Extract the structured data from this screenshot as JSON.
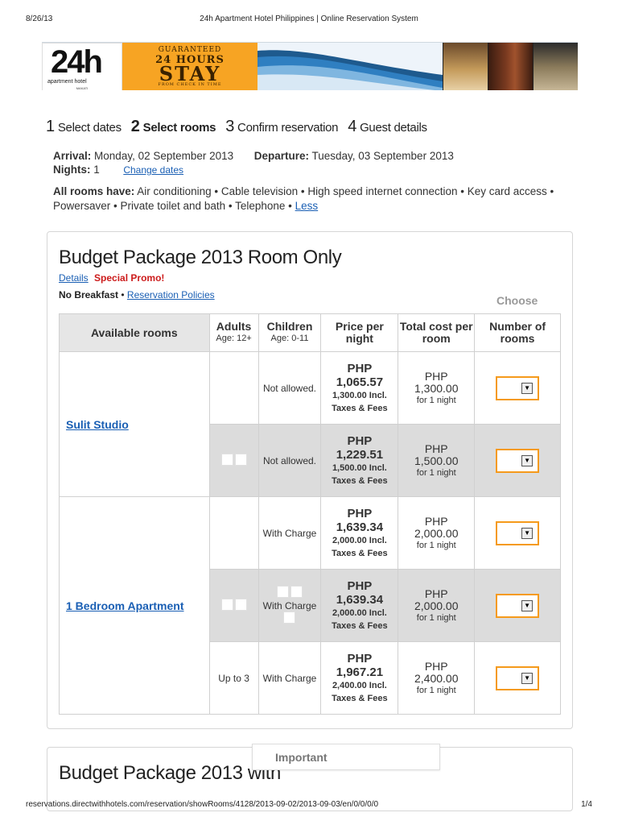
{
  "print_header": {
    "date": "8/26/13",
    "title": "24h Apartment Hotel Philippines | Online Reservation System"
  },
  "banner": {
    "logo_big": "24h",
    "logo_small": "apartment hotel",
    "logo_tiny": "MAKATI",
    "promo_l1": "GUARANTEED",
    "promo_l2": "24 HOURS",
    "promo_l3": "STAY",
    "promo_l4": "FROM CHECK IN TIME"
  },
  "steps": [
    {
      "num": "1",
      "label": "Select dates"
    },
    {
      "num": "2",
      "label": "Select rooms"
    },
    {
      "num": "3",
      "label": "Confirm reservation"
    },
    {
      "num": "4",
      "label": "Guest details"
    }
  ],
  "stay": {
    "arrival_label": "Arrival:",
    "arrival_value": "Monday, 02 September 2013",
    "departure_label": "Departure:",
    "departure_value": "Tuesday, 03 September 2013",
    "nights_label": "Nights:",
    "nights_value": "1",
    "change_dates": "Change dates"
  },
  "amenities": {
    "label": "All rooms have:",
    "text": "Air conditioning • Cable television • High speed internet connection • Key card access • Powersaver • Private toilet and bath • Telephone •",
    "less_link": "Less"
  },
  "package": {
    "title": "Budget Package 2013 Room Only",
    "details_link": "Details",
    "special_promo": "Special Promo!",
    "no_breakfast": "No Breakfast",
    "bullet": "•",
    "policies_link": "Reservation Policies",
    "choose": "Choose",
    "headers": {
      "available": "Available rooms",
      "adults": "Adults",
      "adults_sub": "Age: 12+",
      "children": "Children",
      "children_sub": "Age: 0-11",
      "price": "Price per night",
      "total": "Total cost per room",
      "number": "Number of rooms"
    },
    "rooms": [
      {
        "name": "Sulit Studio",
        "rows": [
          {
            "adults": "",
            "children": "Not allowed.",
            "currency": "PHP",
            "price": "1,065.57",
            "incl": "1,300.00 Incl.",
            "taxes": "Taxes & Fees",
            "total_cur": "PHP",
            "total": "1,300.00",
            "for_nights": "for 1 night"
          },
          {
            "adults": "",
            "children": "Not allowed.",
            "currency": "PHP",
            "price": "1,229.51",
            "incl": "1,500.00 Incl.",
            "taxes": "Taxes & Fees",
            "total_cur": "PHP",
            "total": "1,500.00",
            "for_nights": "for 1 night"
          }
        ]
      },
      {
        "name": "1 Bedroom Apartment",
        "rows": [
          {
            "adults": "",
            "children": "With Charge",
            "currency": "PHP",
            "price": "1,639.34",
            "incl": "2,000.00 Incl.",
            "taxes": "Taxes & Fees",
            "total_cur": "PHP",
            "total": "2,000.00",
            "for_nights": "for 1 night"
          },
          {
            "adults": "",
            "children": "With Charge",
            "currency": "PHP",
            "price": "1,639.34",
            "incl": "2,000.00 Incl.",
            "taxes": "Taxes & Fees",
            "total_cur": "PHP",
            "total": "2,000.00",
            "for_nights": "for 1 night"
          },
          {
            "adults": "Up to 3",
            "children": "With Charge",
            "currency": "PHP",
            "price": "1,967.21",
            "incl": "2,400.00 Incl.",
            "taxes": "Taxes & Fees",
            "total_cur": "PHP",
            "total": "2,400.00",
            "for_nights": "for 1 night"
          }
        ]
      }
    ]
  },
  "package2": {
    "title": "Budget Package 2013 with"
  },
  "important": "Important",
  "print_footer": {
    "url": "reservations.directwithhotels.com/reservation/showRooms/4128/2013-09-02/2013-09-03/en/0/0/0/0",
    "page": "1/4"
  },
  "colors": {
    "link": "#1a5fb4",
    "promo_red": "#cc1b1b",
    "accent_orange": "#f59a1b",
    "row_shade": "#dcdcdc"
  }
}
